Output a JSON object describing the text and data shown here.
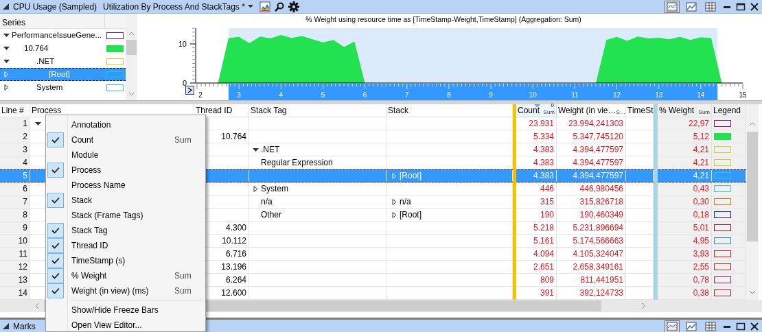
{
  "window": {
    "title": "CPU Usage (Sampled)",
    "preset": "Utilization By Process And StackTags *",
    "view_buttons": [
      {
        "selected": true
      },
      {
        "selected": false
      },
      {
        "selected": false
      }
    ]
  },
  "series": {
    "header": "Series",
    "items": [
      {
        "label": "PerformanceIssueGene...",
        "color": "#7b1c6f",
        "filled": false,
        "expanded": true,
        "selected": false,
        "children": [
          {
            "label": "10.764",
            "color": "#22e34f",
            "filled": true,
            "expanded": true,
            "selected": false,
            "children": [
              {
                "label": ".NET",
                "color": "#c8d42a",
                "filled": false,
                "expanded": true,
                "selected": false,
                "children": [
                  {
                    "label": "[Root]",
                    "color": "#20c8d0",
                    "filled": false,
                    "expanded": false,
                    "selected": true
                  }
                ]
              },
              {
                "label": "System",
                "color": "#30d0b0",
                "filled": false,
                "expanded": false,
                "selected": false
              }
            ]
          }
        ]
      }
    ]
  },
  "chart": {
    "chart_data": {
      "type": "area",
      "title": "% Weight using resource time as [TimeStamp-Weight,TimeStamp] (Aggregation: Sum)",
      "x": [
        2.5,
        2.75,
        3,
        3.25,
        3.5,
        3.75,
        4,
        4.25,
        4.5,
        4.75,
        5,
        5.25,
        5.5,
        5.75,
        6,
        6.25,
        6.5,
        6.75,
        7,
        7.25,
        7.5,
        7.75,
        8,
        8.25,
        8.5,
        8.75,
        9,
        9.25,
        9.5,
        9.75,
        10,
        10.25,
        10.5,
        10.75,
        11,
        11.25,
        11.5,
        11.75,
        12,
        12.25,
        12.5,
        12.75,
        13,
        13.25,
        13.5,
        13.75,
        14,
        14.25,
        14.5,
        14.75
      ],
      "series": [
        {
          "color": "#22e34f",
          "values": [
            0,
            11.5,
            11.8,
            10.2,
            11.9,
            11.4,
            12.3,
            11.5,
            12.0,
            11.2,
            10.4,
            11.0,
            9.2,
            10.6,
            0,
            0,
            0,
            0,
            0,
            0,
            0,
            0,
            0,
            0,
            0,
            0,
            0,
            0,
            0,
            0,
            0,
            0,
            0,
            0,
            0,
            0,
            0,
            11.0,
            11.8,
            10.8,
            11.9,
            11.4,
            11.6,
            11.2,
            11.8,
            11.0,
            11.7,
            11.5,
            0,
            0
          ]
        }
      ],
      "xlim": [
        2,
        15
      ],
      "ylim": [
        0,
        14
      ],
      "xticks": [
        2,
        3,
        4,
        5,
        6,
        7,
        8,
        9,
        10,
        11,
        12,
        13,
        14,
        15
      ],
      "yticks": [
        0,
        10
      ]
    }
  },
  "columns": [
    {
      "label": "Line #",
      "kind": "text"
    },
    {
      "label": "Process",
      "kind": "text"
    },
    {
      "label": "Thread ID",
      "kind": "text"
    },
    {
      "label": "Stack Tag",
      "kind": "text"
    },
    {
      "label": "Stack",
      "kind": "text"
    },
    {
      "kind": "freeze",
      "color": "#f5c400"
    },
    {
      "label": "Count",
      "kind": "text",
      "aggregation": "Sum",
      "sort_mark": "0",
      "sorted": true
    },
    {
      "label": "Weight (in vie…",
      "kind": "text",
      "aggregation": "S…",
      "sorted": false
    },
    {
      "label": "TimeSt",
      "kind": "text",
      "sorted": false
    },
    {
      "kind": "freeze",
      "color": "#a8d4e6"
    },
    {
      "label": "% Weight",
      "kind": "text",
      "aggregation": "Sum",
      "sorted": false
    },
    {
      "label": "Legend",
      "kind": "text"
    }
  ],
  "rows": [
    {
      "line": "1",
      "process": {
        "expanded": true
      },
      "count": "23.931",
      "weight": "23.994,241303",
      "pct_weight": "22,97",
      "color": "#7b1c6f",
      "filled": false,
      "selected": false
    },
    {
      "line": "2",
      "thread_id": "10.764",
      "count": "5.334",
      "weight": "5.347,745120",
      "pct_weight": "5,12",
      "color": "#22e34f",
      "filled": true,
      "selected": false
    },
    {
      "line": "3",
      "stack_tag": {
        "text": ".NET",
        "expanded": true
      },
      "count": "4.383",
      "weight": "4.394,477597",
      "pct_weight": "4,21",
      "color": "#c8d42a",
      "filled": false,
      "selected": false
    },
    {
      "line": "4",
      "stack_tag": {
        "text": "Regular Expression"
      },
      "count": "4.383",
      "weight": "4.394,477597",
      "pct_weight": "4,21",
      "color": "#c8d42a",
      "filled": false,
      "selected": false
    },
    {
      "line": "5",
      "stack": {
        "text": "[Root]",
        "expanded": false
      },
      "count": "4.383",
      "weight": "4.394,477597",
      "pct_weight": "4,21",
      "color": "#20c8d0",
      "filled": false,
      "selected": true
    },
    {
      "line": "6",
      "stack_tag": {
        "text": "System",
        "expanded": false
      },
      "count": "446",
      "weight": "446,980456",
      "pct_weight": "0,43",
      "color": "#30d0b0",
      "filled": false,
      "selected": false
    },
    {
      "line": "7",
      "stack_tag": {
        "text": "n/a"
      },
      "stack": {
        "text": "n/a",
        "expanded": false
      },
      "count": "315",
      "weight": "315,826718",
      "pct_weight": "0,30",
      "color": "#e07020",
      "filled": false,
      "selected": false
    },
    {
      "line": "8",
      "stack_tag": {
        "text": "Other"
      },
      "stack": {
        "text": "[Root]",
        "expanded": false
      },
      "count": "190",
      "weight": "190,460349",
      "pct_weight": "0,18",
      "color": "#2020a0",
      "filled": false,
      "selected": false
    },
    {
      "line": "9",
      "thread_id": "4.300",
      "count": "5.218",
      "weight": "5.231,896694",
      "pct_weight": "5,01",
      "color": "#901030",
      "filled": false,
      "selected": false
    },
    {
      "line": "10",
      "thread_id": "10.112",
      "count": "5.161",
      "weight": "5.174,566663",
      "pct_weight": "4,95",
      "color": "#2090c0",
      "filled": false,
      "selected": false
    },
    {
      "line": "11",
      "thread_id": "6.716",
      "count": "4.094",
      "weight": "4.105,324047",
      "pct_weight": "3,93",
      "color": "#c02020",
      "filled": false,
      "selected": false
    },
    {
      "line": "12",
      "thread_id": "13.196",
      "count": "2.651",
      "weight": "2.658,349161",
      "pct_weight": "2,55",
      "color": "#a03020",
      "filled": false,
      "selected": false
    },
    {
      "line": "13",
      "thread_id": "6.264",
      "count": "809",
      "weight": "811,441951",
      "pct_weight": "0,78",
      "color": "#902060",
      "filled": false,
      "selected": false
    },
    {
      "line": "14",
      "thread_id": "12.600",
      "count": "391",
      "weight": "392,124733",
      "pct_weight": "0,38",
      "color": "#b02020",
      "filled": false,
      "selected": false
    }
  ],
  "context_menu": {
    "items": [
      {
        "kind": "column",
        "label": "Annotation",
        "checked": false
      },
      {
        "kind": "column",
        "label": "Count",
        "checked": true,
        "aggregation": "Sum"
      },
      {
        "kind": "column",
        "label": "Module",
        "checked": false
      },
      {
        "kind": "column",
        "label": "Process",
        "checked": true
      },
      {
        "kind": "column",
        "label": "Process Name",
        "checked": false
      },
      {
        "kind": "column",
        "label": "Stack",
        "checked": true
      },
      {
        "kind": "column",
        "label": "Stack (Frame Tags)",
        "checked": false
      },
      {
        "kind": "column",
        "label": "Stack Tag",
        "checked": true
      },
      {
        "kind": "column",
        "label": "Thread ID",
        "checked": true
      },
      {
        "kind": "column",
        "label": "TimeStamp (s)",
        "checked": true
      },
      {
        "kind": "column",
        "label": "% Weight",
        "checked": true,
        "aggregation": "Sum"
      },
      {
        "kind": "column",
        "label": "Weight (in view) (ms)",
        "checked": true,
        "aggregation": "Sum"
      },
      {
        "kind": "separator"
      },
      {
        "kind": "action",
        "label": "Show/Hide Freeze Bars"
      },
      {
        "kind": "action",
        "label": "Open View Editor..."
      }
    ]
  },
  "bottom_panel": {
    "title": "Marks"
  }
}
